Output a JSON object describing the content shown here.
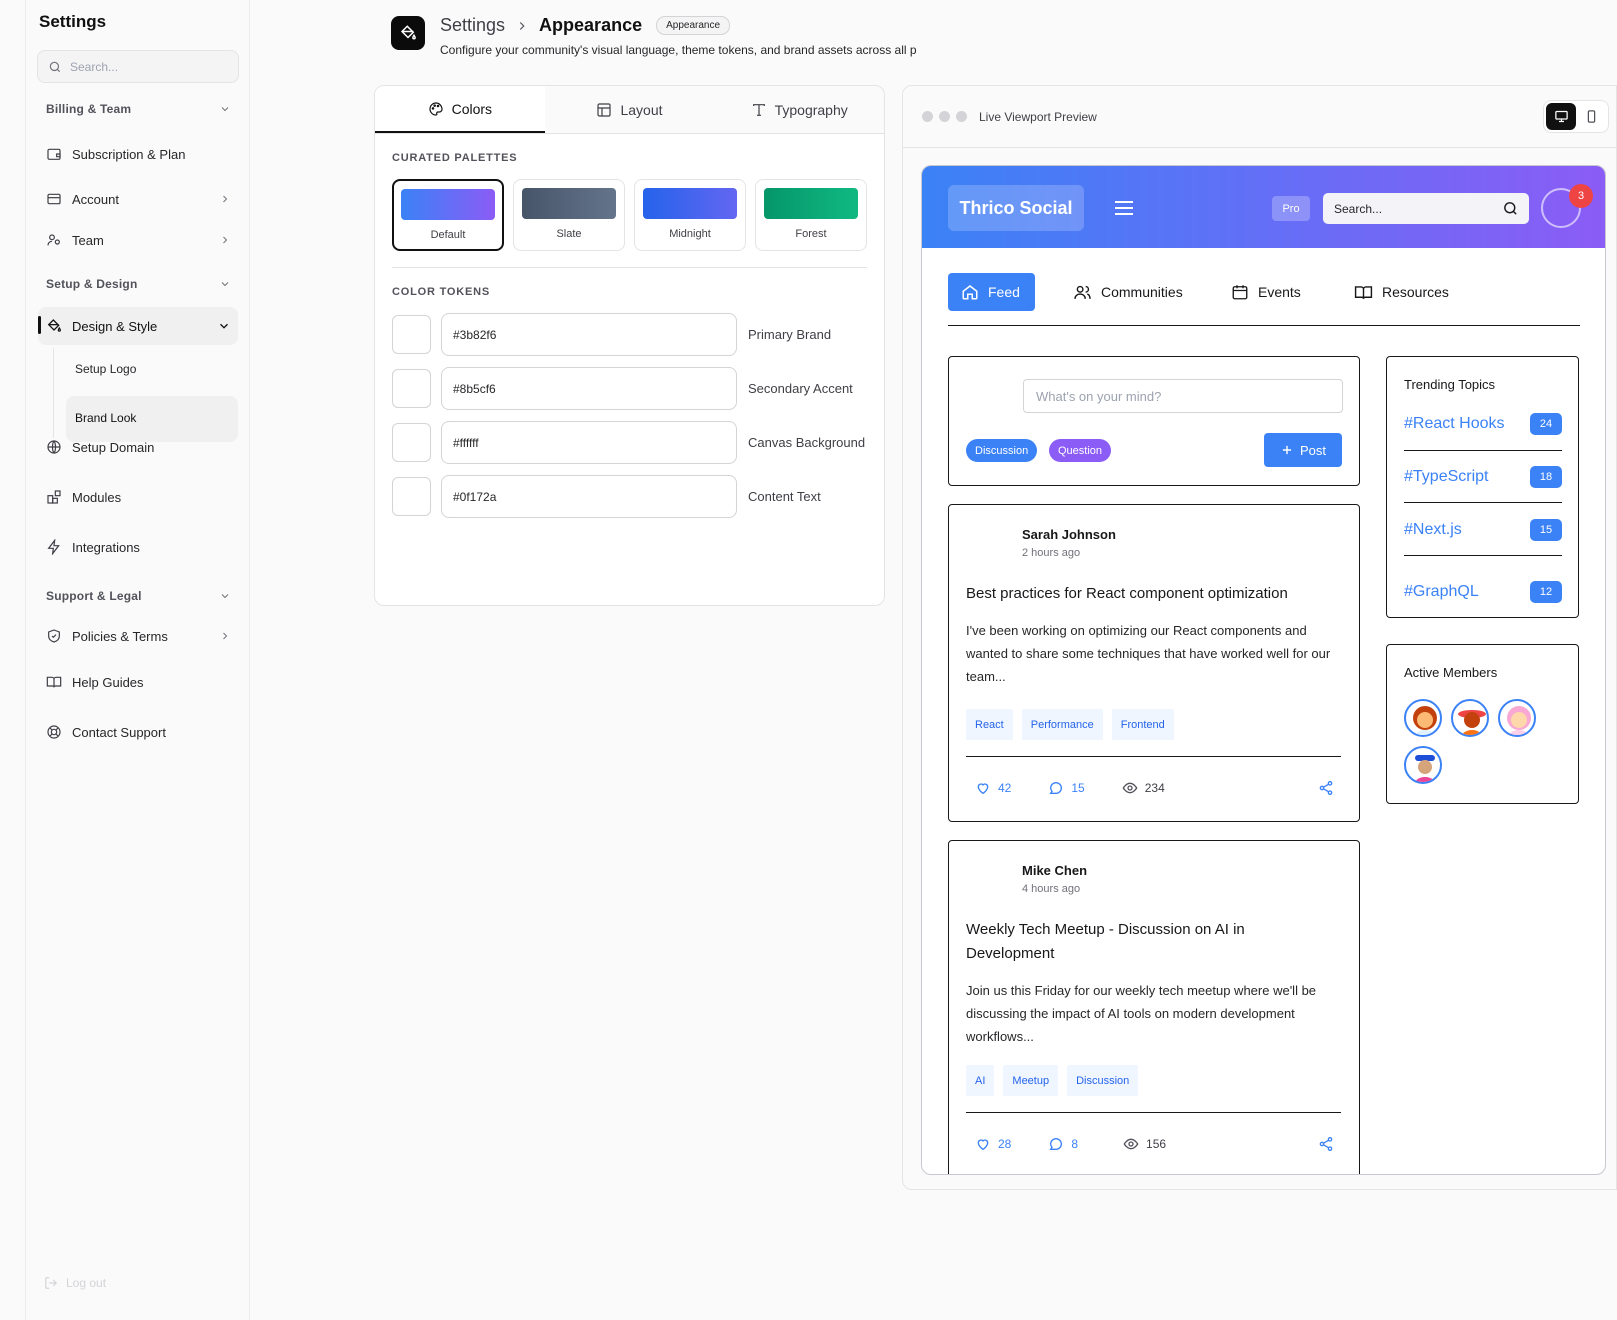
{
  "sidebar": {
    "title": "Settings",
    "search_placeholder": "Search...",
    "sections": [
      {
        "label": "Billing & Team"
      },
      {
        "label": "Setup & Design"
      },
      {
        "label": "Support & Legal"
      }
    ],
    "items": {
      "subscription": "Subscription & Plan",
      "account": "Account",
      "team": "Team",
      "design_style": "Design & Style",
      "setup_logo": "Setup Logo",
      "brand_look": "Brand Look",
      "setup_domain": "Setup Domain",
      "modules": "Modules",
      "integrations": "Integrations",
      "policies": "Policies & Terms",
      "help": "Help Guides",
      "contact": "Contact Support"
    },
    "logout": "Log out"
  },
  "header": {
    "crumb_root": "Settings",
    "crumb_current": "Appearance",
    "badge": "Appearance",
    "description": "Configure your community's visual language, theme tokens, and brand assets across all p"
  },
  "editor": {
    "tabs": [
      "Colors",
      "Layout",
      "Typography"
    ],
    "palettes_label": "CURATED PALETTES",
    "palettes": [
      {
        "name": "Default",
        "from": "#3b82f6",
        "to": "#8b5cf6"
      },
      {
        "name": "Slate",
        "from": "#475569",
        "to": "#64748b"
      },
      {
        "name": "Midnight",
        "from": "#2563eb",
        "to": "#6366f1"
      },
      {
        "name": "Forest",
        "from": "#059669",
        "to": "#10b981"
      }
    ],
    "tokens_label": "COLOR TOKENS",
    "tokens": [
      {
        "value": "#3b82f6",
        "label": "Primary Brand"
      },
      {
        "value": "#8b5cf6",
        "label": "Secondary Accent"
      },
      {
        "value": "#ffffff",
        "label": "Canvas Background"
      },
      {
        "value": "#0f172a",
        "label": "Content Text"
      }
    ]
  },
  "preview": {
    "title": "Live Viewport Preview",
    "brand": "Thrico Social",
    "pro": "Pro",
    "search": "Search...",
    "notifications": "3",
    "nav": [
      "Feed",
      "Communities",
      "Events",
      "Resources"
    ],
    "composer": {
      "placeholder": "What's on your mind?",
      "tag1": "Discussion",
      "tag2": "Question",
      "post": "Post"
    },
    "posts": [
      {
        "author": "Sarah Johnson",
        "time": "2 hours ago",
        "title": "Best practices for React component optimization",
        "body": "I've been working on optimizing our React components and wanted to share some techniques that have worked well for our team...",
        "tags": [
          "React",
          "Performance",
          "Frontend"
        ],
        "likes": "42",
        "comments": "15",
        "views": "234"
      },
      {
        "author": "Mike Chen",
        "time": "4 hours ago",
        "title": "Weekly Tech Meetup - Discussion on AI in Development",
        "body": "Join us this Friday for our weekly tech meetup where we'll be discussing the impact of AI tools on modern development workflows...",
        "tags": [
          "AI",
          "Meetup",
          "Discussion"
        ],
        "likes": "28",
        "comments": "8",
        "views": "156"
      }
    ],
    "trending": {
      "title": "Trending Topics",
      "items": [
        {
          "name": "#React Hooks",
          "count": "24"
        },
        {
          "name": "#TypeScript",
          "count": "18"
        },
        {
          "name": "#Next.js",
          "count": "15"
        },
        {
          "name": "#GraphQL",
          "count": "12"
        }
      ]
    },
    "members_title": "Active Members"
  }
}
